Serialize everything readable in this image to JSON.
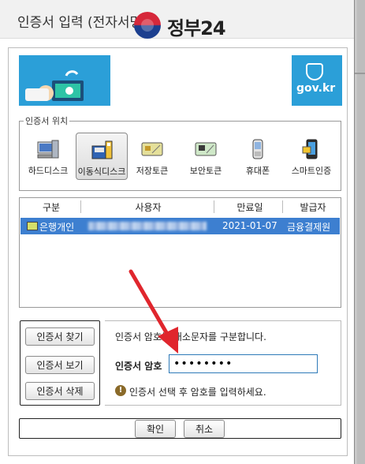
{
  "window": {
    "title": "인증서 입력 (전자서명)"
  },
  "banner": {
    "brand": "정부24",
    "domain": "gov.kr"
  },
  "location": {
    "legend": "인증서 위치",
    "items": [
      {
        "label": "하드디스크",
        "icon": "hard-disk-icon"
      },
      {
        "label": "이동식디스크",
        "icon": "removable-disk-icon",
        "selected": true
      },
      {
        "label": "저장토큰",
        "icon": "storage-token-icon"
      },
      {
        "label": "보안토큰",
        "icon": "security-token-icon"
      },
      {
        "label": "휴대폰",
        "icon": "phone-icon"
      },
      {
        "label": "스마트인증",
        "icon": "smart-auth-icon"
      }
    ]
  },
  "cert_table": {
    "columns": [
      "구분",
      "사용자",
      "만료일",
      "발급자"
    ],
    "rows": [
      {
        "type": "은행개인",
        "expiry": "2021-01-07",
        "issuer": "금융결제원",
        "selected": true
      }
    ]
  },
  "cert_buttons": {
    "find": "인증서 찾기",
    "view": "인증서 보기",
    "delete": "인증서 삭제"
  },
  "password": {
    "hint": "인증서 암호는 대소문자를 구분합니다.",
    "label": "인증서 암호",
    "value": "••••••••",
    "info": "인증서 선택 후 암호를 입력하세요."
  },
  "footer": {
    "ok": "확인",
    "cancel": "취소"
  },
  "colors": {
    "banner": "#2b9fd8",
    "selection": "#3d7fd0",
    "arrow": "#e0262d"
  }
}
